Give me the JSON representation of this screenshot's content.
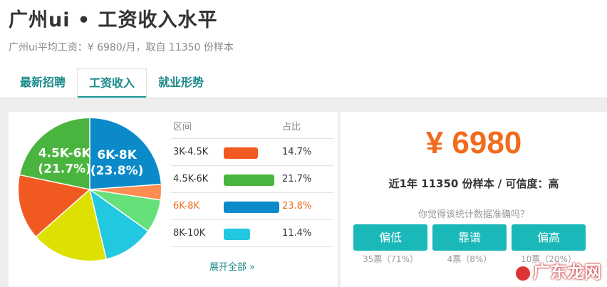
{
  "header": {
    "title": "广州ui • 工资收入水平",
    "subtitle": "广州ui平均工资：¥ 6980/月，取自 11350 份样本"
  },
  "tabs": [
    {
      "label": "最新招聘",
      "active": false
    },
    {
      "label": "工资收入",
      "active": true
    },
    {
      "label": "就业形势",
      "active": false
    }
  ],
  "chart_data": {
    "type": "pie",
    "slices": [
      {
        "label": "6K-8K",
        "value": 23.8,
        "color": "#0a8ac8",
        "annotated": "(23.8%)"
      },
      {
        "label": "",
        "value": 3.5,
        "color": "#ff8c50"
      },
      {
        "label": "",
        "value": 7.5,
        "color": "#66e07a"
      },
      {
        "label": "8K-10K",
        "value": 11.4,
        "color": "#22c8e0"
      },
      {
        "label": "",
        "value": 17.2,
        "color": "#dde000"
      },
      {
        "label": "3K-4.5K",
        "value": 14.7,
        "color": "#f05a20"
      },
      {
        "label": "4.5K-6K",
        "value": 21.7,
        "color": "#4ab53e",
        "annotated": "(21.7%)"
      }
    ],
    "legend": {
      "headers": {
        "range": "区间",
        "share": "占比"
      },
      "rows": [
        {
          "range": "3K-4.5K",
          "share": "14.7%",
          "value": 14.7,
          "color": "#f05a20",
          "highlight": false
        },
        {
          "range": "4.5K-6K",
          "share": "21.7%",
          "value": 21.7,
          "color": "#4ab53e",
          "highlight": false
        },
        {
          "range": "6K-8K",
          "share": "23.8%",
          "value": 23.8,
          "color": "#0a8ac8",
          "highlight": true
        },
        {
          "range": "8K-10K",
          "share": "11.4%",
          "value": 11.4,
          "color": "#22c8e0",
          "highlight": false
        }
      ]
    }
  },
  "show_all": "展开全部 »",
  "summary": {
    "salary": "¥ 6980",
    "stats": "近1年 11350 份样本 / 可信度：高",
    "question": "你觉得该统计数据准确吗？"
  },
  "votes": [
    {
      "label": "偏低",
      "count": "35票（71%）"
    },
    {
      "label": "靠谱",
      "count": "4票（8%）"
    },
    {
      "label": "偏高",
      "count": "10票（20%）"
    }
  ],
  "watermark": "广东龙网",
  "colors": {
    "accent": "#1a8a8a",
    "button": "#1ab8b8",
    "orange": "#f26b1d"
  }
}
